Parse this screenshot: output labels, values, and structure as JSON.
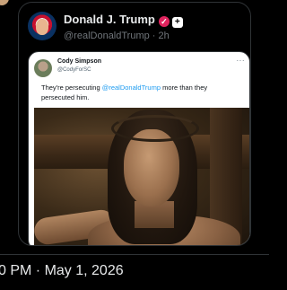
{
  "top": {
    "name": ""
  },
  "post": {
    "author_name": "Donald J. Trump",
    "handle_time": "@realDonaldTrump · 2h"
  },
  "quoted": {
    "author_name": "Cody Simpson",
    "handle": "@CodyForSC",
    "more": "···",
    "text_before": "They're persecuting ",
    "mention": "@realDonaldTrump",
    "text_after": " more than they persecuted him."
  },
  "footer": {
    "timestamp": "0 PM · May 1, 2026"
  },
  "colors": {
    "link": "#1d9bf0",
    "muted": "#71767b",
    "badge": "#e0245e"
  },
  "icons": [
    "verified-badge-icon",
    "affiliate-badge-icon",
    "more-icon"
  ]
}
